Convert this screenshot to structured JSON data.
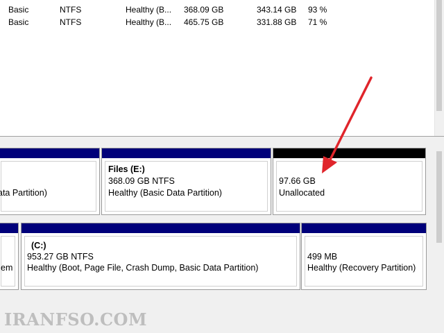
{
  "volume_list": {
    "rows": [
      {
        "type": "Basic",
        "fs": "NTFS",
        "status": "Healthy (B...",
        "capacity": "368.09 GB",
        "free": "343.14 GB",
        "pct": "93 %"
      },
      {
        "type": "Basic",
        "fs": "NTFS",
        "status": "Healthy (B...",
        "capacity": "465.75 GB",
        "free": "331.88 GB",
        "pct": "71 %"
      }
    ]
  },
  "disk_view": {
    "disk1": {
      "partition_left": {
        "status": "ata Partition)"
      },
      "partition_files": {
        "name": "Files  (E:)",
        "size": "368.09 GB NTFS",
        "status": "Healthy (Basic Data Partition)"
      },
      "partition_unallocated": {
        "size": "97.66 GB",
        "status": "Unallocated"
      }
    },
    "disk2": {
      "partition_left": {
        "status": "em"
      },
      "partition_c": {
        "name": "(C:)",
        "size": "953.27 GB NTFS",
        "status": "Healthy (Boot, Page File, Crash Dump, Basic Data Partition)"
      },
      "partition_recovery": {
        "size": "499 MB",
        "status": "Healthy (Recovery Partition)"
      }
    }
  },
  "colors": {
    "primary_partition_bar": "#00007a",
    "unallocated_bar": "#000000",
    "arrow": "#e0252b"
  },
  "watermark": "IRANFSO.COM"
}
